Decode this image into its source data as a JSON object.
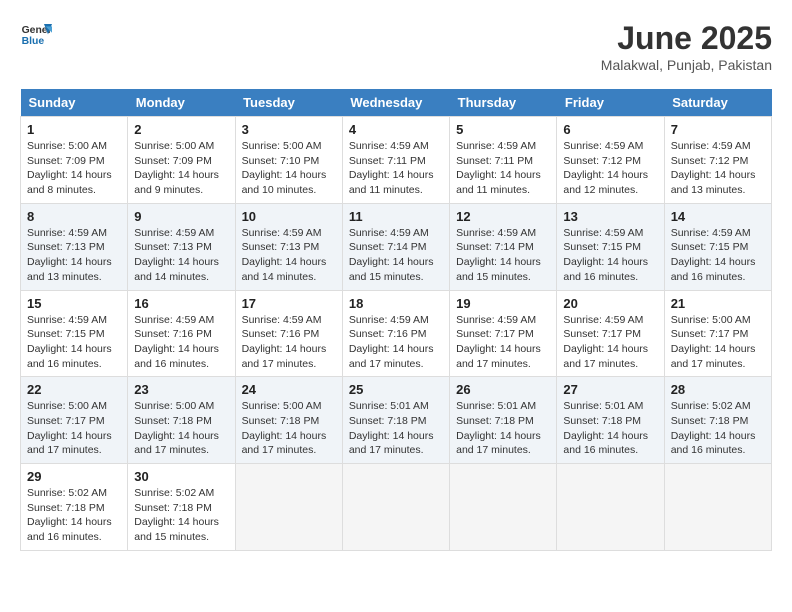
{
  "logo": {
    "line1": "General",
    "line2": "Blue"
  },
  "title": "June 2025",
  "location": "Malakwal, Punjab, Pakistan",
  "headers": [
    "Sunday",
    "Monday",
    "Tuesday",
    "Wednesday",
    "Thursday",
    "Friday",
    "Saturday"
  ],
  "rows": [
    [
      {
        "day": "1",
        "sunrise": "5:00 AM",
        "sunset": "7:09 PM",
        "daylight": "14 hours and 8 minutes."
      },
      {
        "day": "2",
        "sunrise": "5:00 AM",
        "sunset": "7:09 PM",
        "daylight": "14 hours and 9 minutes."
      },
      {
        "day": "3",
        "sunrise": "5:00 AM",
        "sunset": "7:10 PM",
        "daylight": "14 hours and 10 minutes."
      },
      {
        "day": "4",
        "sunrise": "4:59 AM",
        "sunset": "7:11 PM",
        "daylight": "14 hours and 11 minutes."
      },
      {
        "day": "5",
        "sunrise": "4:59 AM",
        "sunset": "7:11 PM",
        "daylight": "14 hours and 11 minutes."
      },
      {
        "day": "6",
        "sunrise": "4:59 AM",
        "sunset": "7:12 PM",
        "daylight": "14 hours and 12 minutes."
      },
      {
        "day": "7",
        "sunrise": "4:59 AM",
        "sunset": "7:12 PM",
        "daylight": "14 hours and 13 minutes."
      }
    ],
    [
      {
        "day": "8",
        "sunrise": "4:59 AM",
        "sunset": "7:13 PM",
        "daylight": "14 hours and 13 minutes."
      },
      {
        "day": "9",
        "sunrise": "4:59 AM",
        "sunset": "7:13 PM",
        "daylight": "14 hours and 14 minutes."
      },
      {
        "day": "10",
        "sunrise": "4:59 AM",
        "sunset": "7:13 PM",
        "daylight": "14 hours and 14 minutes."
      },
      {
        "day": "11",
        "sunrise": "4:59 AM",
        "sunset": "7:14 PM",
        "daylight": "14 hours and 15 minutes."
      },
      {
        "day": "12",
        "sunrise": "4:59 AM",
        "sunset": "7:14 PM",
        "daylight": "14 hours and 15 minutes."
      },
      {
        "day": "13",
        "sunrise": "4:59 AM",
        "sunset": "7:15 PM",
        "daylight": "14 hours and 16 minutes."
      },
      {
        "day": "14",
        "sunrise": "4:59 AM",
        "sunset": "7:15 PM",
        "daylight": "14 hours and 16 minutes."
      }
    ],
    [
      {
        "day": "15",
        "sunrise": "4:59 AM",
        "sunset": "7:15 PM",
        "daylight": "14 hours and 16 minutes."
      },
      {
        "day": "16",
        "sunrise": "4:59 AM",
        "sunset": "7:16 PM",
        "daylight": "14 hours and 16 minutes."
      },
      {
        "day": "17",
        "sunrise": "4:59 AM",
        "sunset": "7:16 PM",
        "daylight": "14 hours and 17 minutes."
      },
      {
        "day": "18",
        "sunrise": "4:59 AM",
        "sunset": "7:16 PM",
        "daylight": "14 hours and 17 minutes."
      },
      {
        "day": "19",
        "sunrise": "4:59 AM",
        "sunset": "7:17 PM",
        "daylight": "14 hours and 17 minutes."
      },
      {
        "day": "20",
        "sunrise": "4:59 AM",
        "sunset": "7:17 PM",
        "daylight": "14 hours and 17 minutes."
      },
      {
        "day": "21",
        "sunrise": "5:00 AM",
        "sunset": "7:17 PM",
        "daylight": "14 hours and 17 minutes."
      }
    ],
    [
      {
        "day": "22",
        "sunrise": "5:00 AM",
        "sunset": "7:17 PM",
        "daylight": "14 hours and 17 minutes."
      },
      {
        "day": "23",
        "sunrise": "5:00 AM",
        "sunset": "7:18 PM",
        "daylight": "14 hours and 17 minutes."
      },
      {
        "day": "24",
        "sunrise": "5:00 AM",
        "sunset": "7:18 PM",
        "daylight": "14 hours and 17 minutes."
      },
      {
        "day": "25",
        "sunrise": "5:01 AM",
        "sunset": "7:18 PM",
        "daylight": "14 hours and 17 minutes."
      },
      {
        "day": "26",
        "sunrise": "5:01 AM",
        "sunset": "7:18 PM",
        "daylight": "14 hours and 17 minutes."
      },
      {
        "day": "27",
        "sunrise": "5:01 AM",
        "sunset": "7:18 PM",
        "daylight": "14 hours and 16 minutes."
      },
      {
        "day": "28",
        "sunrise": "5:02 AM",
        "sunset": "7:18 PM",
        "daylight": "14 hours and 16 minutes."
      }
    ],
    [
      {
        "day": "29",
        "sunrise": "5:02 AM",
        "sunset": "7:18 PM",
        "daylight": "14 hours and 16 minutes."
      },
      {
        "day": "30",
        "sunrise": "5:02 AM",
        "sunset": "7:18 PM",
        "daylight": "14 hours and 15 minutes."
      },
      null,
      null,
      null,
      null,
      null
    ]
  ]
}
